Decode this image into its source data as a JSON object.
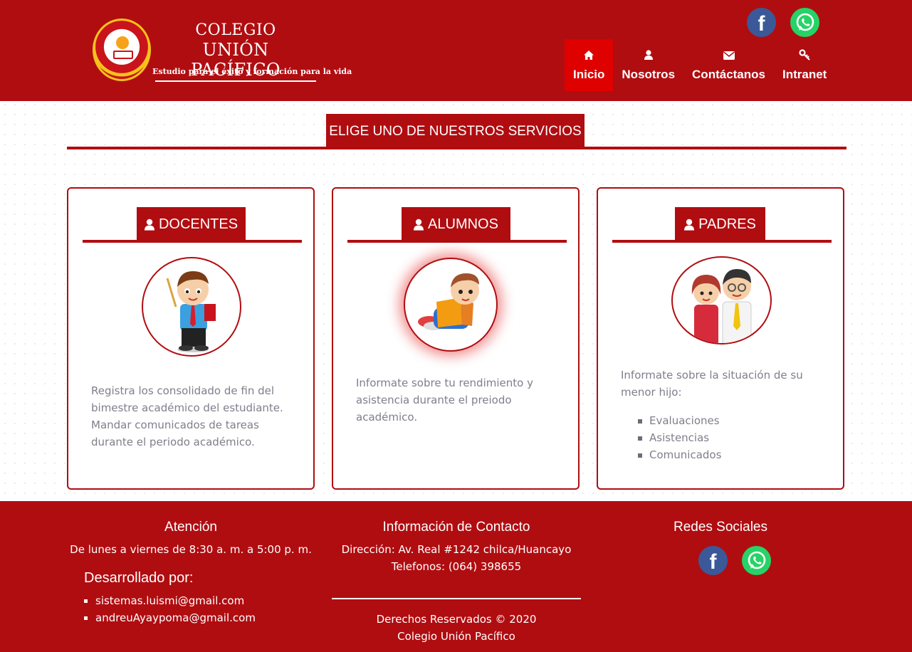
{
  "header": {
    "logo_line1": "COLEGIO",
    "logo_line2": "UNIÓN PACÍFICO",
    "logo_tagline": "Estudio para el éxito y formación para la vida",
    "social": [
      {
        "name": "facebook",
        "icon": "facebook-icon",
        "color": "#3b5998"
      },
      {
        "name": "whatsapp",
        "icon": "whatsapp-icon",
        "color": "#25d366"
      }
    ],
    "nav": [
      {
        "label": "Inicio",
        "icon": "home-icon",
        "active": true
      },
      {
        "label": "Nosotros",
        "icon": "user-icon",
        "active": false
      },
      {
        "label": "Contáctanos",
        "icon": "envelope-icon",
        "active": false
      },
      {
        "label": "Intranet",
        "icon": "key-icon",
        "active": false
      }
    ]
  },
  "main": {
    "section_title": "ELIGE UNO DE NUESTROS SERVICIOS",
    "cards": [
      {
        "title": "DOCENTES",
        "icon": "user-icon",
        "image": "teacher-illustration",
        "description": "Registra los consolidado de fin del bimestre académico del estudiante. Mandar comunicados de tareas durante el periodo académico."
      },
      {
        "title": "ALUMNOS",
        "icon": "user-icon",
        "image": "student-reading-illustration",
        "description": "Informate sobre tu rendimiento y asistencia durante el preiodo académico."
      },
      {
        "title": "PADRES",
        "icon": "user-icon",
        "image": "parents-illustration",
        "description": "Informate sobre la situación de su menor hijo:",
        "items": [
          "Evaluaciones",
          "Asistencias",
          "Comunicados"
        ]
      }
    ]
  },
  "footer": {
    "atencion_title": "Atención",
    "atencion_text": "De lunes a viernes de 8:30 a. m. a 5:00 p. m.",
    "dev_title": "Desarrollado por:",
    "dev_emails": [
      "sistemas.luismi@gmail.com",
      "andreuAyaypoma@gmail.com"
    ],
    "contact_title": "Información de Contacto",
    "address": "Dirección: Av. Real #1242 chilca/Huancayo",
    "phone": "Telefonos: (064) 398655",
    "rights_line1": "Derechos Reservados © 2020",
    "rights_line2": "Colegio Unión Pacífico",
    "social_title": "Redes Sociales"
  },
  "colors": {
    "brand": "#b00d11",
    "active_nav": "#df0000",
    "text_muted": "#7f7f8c"
  }
}
